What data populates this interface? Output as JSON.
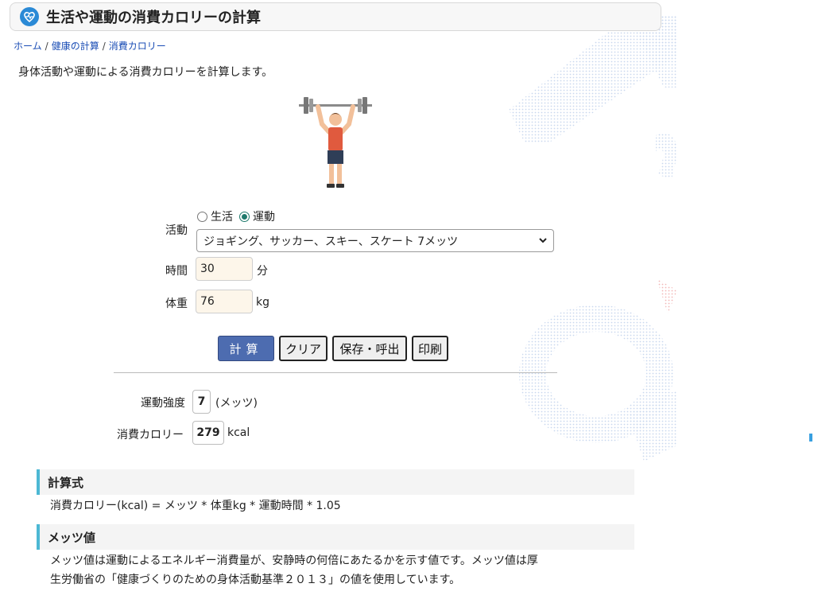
{
  "header": {
    "title": "生活や運動の消費カロリーの計算",
    "icon": "heart-pulse-icon"
  },
  "breadcrumb": {
    "home": "ホーム",
    "category": "健康の計算",
    "current": "消費カロリー",
    "separator": "/"
  },
  "intro": "身体活動や運動による消費カロリーを計算します。",
  "form": {
    "activity_label": "活動",
    "radio_life": "生活",
    "radio_exercise": "運動",
    "selected_mode": "運動",
    "activity_selected": "ジョギング、サッカー、スキー、スケート 7メッツ",
    "time_label": "時間",
    "time_value": "30",
    "time_unit": "分",
    "weight_label": "体重",
    "weight_value": "76",
    "weight_unit": "kg"
  },
  "buttons": {
    "calc": "計算",
    "clear": "クリア",
    "save": "保存・呼出",
    "print": "印刷"
  },
  "results": {
    "intensity_label": "運動強度",
    "intensity_value": "7",
    "intensity_unit": "(メッツ)",
    "calorie_label": "消費カロリー",
    "calorie_value": "279",
    "calorie_unit": "kcal"
  },
  "formula": {
    "heading": "計算式",
    "text": "消費カロリー(kcal) = メッツ * 体重kg * 運動時間 * 1.05"
  },
  "mets": {
    "heading": "メッツ値",
    "line1": "メッツ値は運動によるエネルギー消費量が、安静時の何倍にあたるかを示す値です。メッツ値は厚",
    "line2": "生労働省の「健康づくりのための身体活動基準２０１３」の値を使用しています。"
  },
  "colors": {
    "accent": "#4d6cb0",
    "section_bar": "#4cb8d4",
    "input_bg": "#fdf6ea",
    "link": "#1a4db5"
  }
}
